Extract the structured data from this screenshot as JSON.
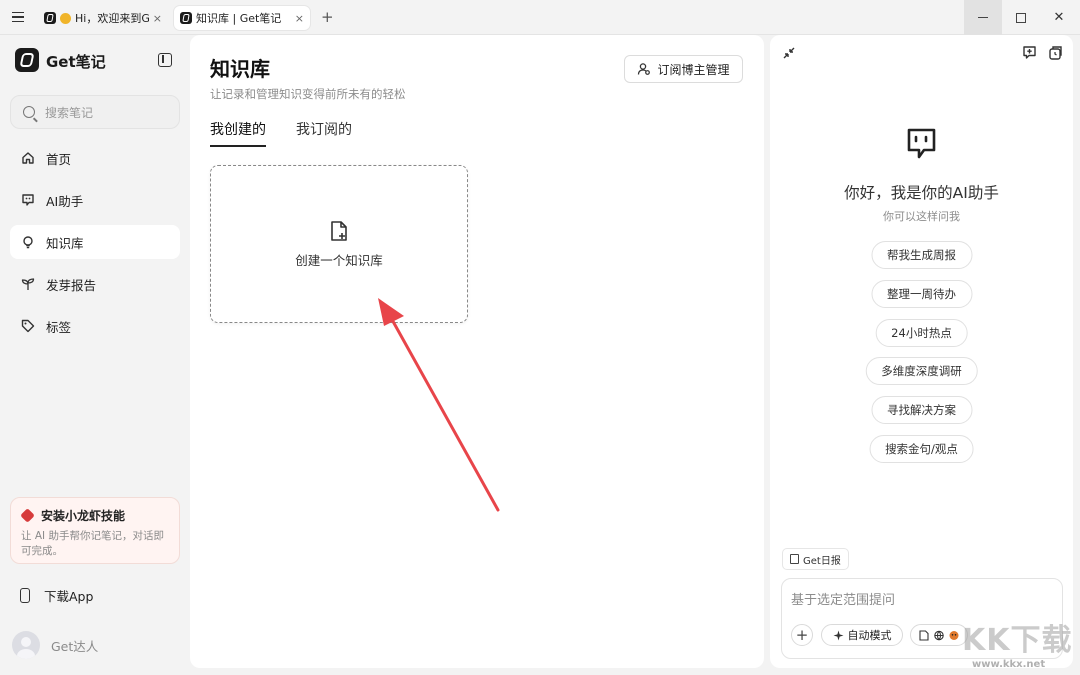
{
  "window": {
    "tabs": [
      {
        "label": "Hi，欢迎来到Ge",
        "close": "×"
      },
      {
        "label": "知识库 | Get笔记",
        "close": "×"
      }
    ],
    "new_tab": "+",
    "controls": {
      "close": "✕"
    }
  },
  "sidebar": {
    "brand": "Get笔记",
    "search_placeholder": "搜索笔记",
    "items": [
      {
        "label": "首页",
        "icon": "home-icon"
      },
      {
        "label": "AI助手",
        "icon": "chat-bot-icon"
      },
      {
        "label": "知识库",
        "icon": "lightbulb-icon",
        "active": true
      },
      {
        "label": "发芽报告",
        "icon": "sprout-icon"
      },
      {
        "label": "标签",
        "icon": "tag-icon"
      }
    ],
    "promo": {
      "title": "安装小龙虾技能",
      "desc": "让 AI 助手帮你记笔记，对话即可完成。"
    },
    "download": "下载App",
    "user": "Get达人"
  },
  "main": {
    "title": "知识库",
    "subtitle": "让记录和管理知识变得前所未有的轻松",
    "subscribe_button": "订阅博主管理",
    "tabs": [
      {
        "label": "我创建的",
        "active": true
      },
      {
        "label": "我订阅的",
        "active": false
      }
    ],
    "create_card": "创建一个知识库",
    "annotation_color": "#e8454a"
  },
  "ai_panel": {
    "greeting": "你好，我是你的AI助手",
    "hint": "你可以这样问我",
    "suggestions": [
      "帮我生成周报",
      "整理一周待办",
      "24小时热点",
      "多维度深度调研",
      "寻找解决方案",
      "搜索金句/观点"
    ],
    "daily_tag": "Get日报",
    "input_placeholder": "基于选定范围提问",
    "plus": "+",
    "mode": "自动模式"
  },
  "watermark": {
    "text": "KK下载",
    "url": "www.kkx.net"
  }
}
